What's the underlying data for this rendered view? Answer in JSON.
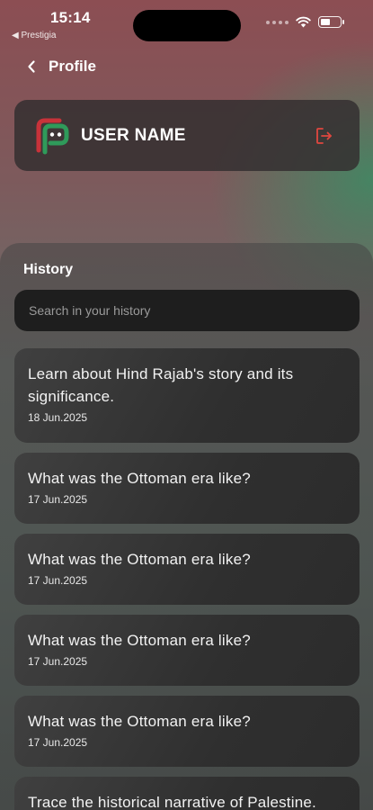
{
  "status_bar": {
    "time": "15:14",
    "back_app": "◀ Prestigia"
  },
  "nav": {
    "title": "Profile"
  },
  "user": {
    "name": "USER NAME"
  },
  "history": {
    "title": "History",
    "search_placeholder": "Search in your history",
    "items": [
      {
        "question": "Learn about Hind Rajab's story and its significance.",
        "date": "18 Jun.2025"
      },
      {
        "question": "What was the Ottoman era like?",
        "date": "17 Jun.2025"
      },
      {
        "question": "What was the Ottoman era like?",
        "date": "17 Jun.2025"
      },
      {
        "question": "What was the Ottoman era like?",
        "date": "17 Jun.2025"
      },
      {
        "question": "What was the Ottoman era like?",
        "date": "17 Jun.2025"
      },
      {
        "question": "Trace the historical narrative of Palestine.",
        "date": ""
      }
    ]
  },
  "colors": {
    "logo_red": "#c8323a",
    "logo_green": "#2f9a5a",
    "logout_red": "#e0473f"
  }
}
